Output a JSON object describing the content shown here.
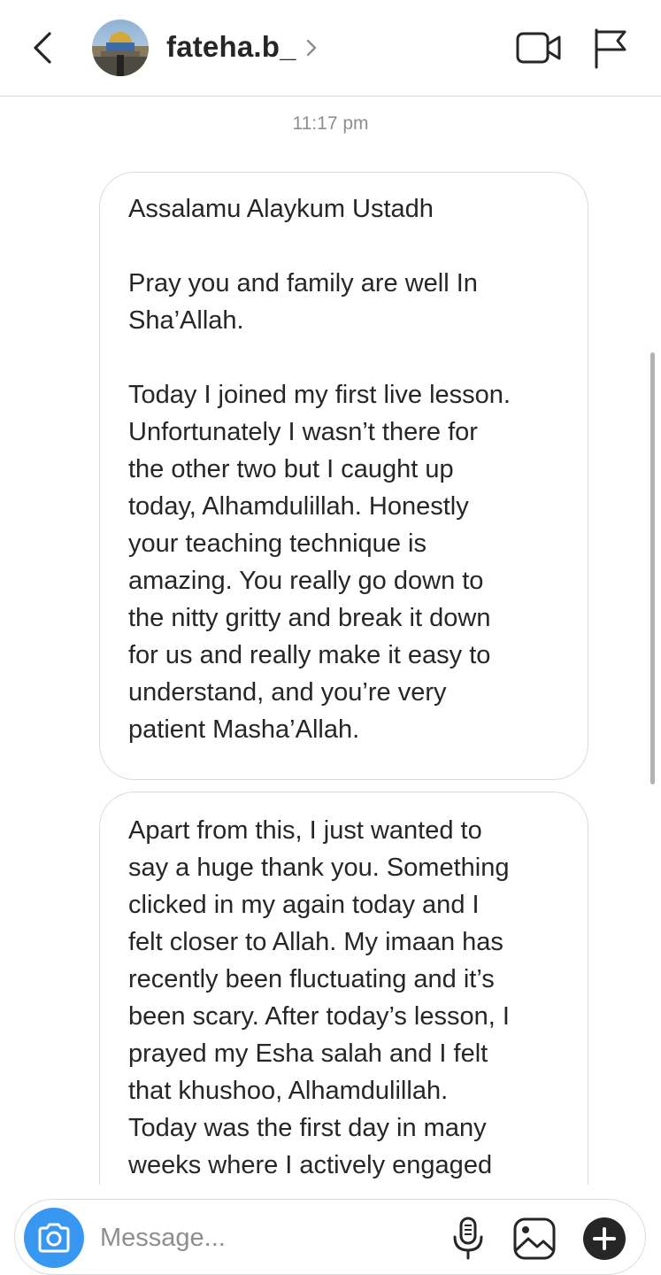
{
  "header": {
    "username": "fateha.b_",
    "chevron": "›"
  },
  "thread": {
    "timestamp": "11:17 pm",
    "messages": [
      {
        "paragraphs": [
          "Assalamu Alaykum Ustadh",
          "Pray you and family are well In\nSha’Allah.",
          "Today I joined my first live lesson.\nUnfortunately I wasn’t there for\nthe other two but I caught up\ntoday, Alhamdulillah. Honestly\nyour teaching technique is\namazing. You really go down to\nthe nitty gritty and break it down\nfor us and really make it easy to\nunderstand, and you’re very\npatient Masha’Allah."
        ]
      },
      {
        "paragraphs": [
          "Apart from this, I just wanted to\nsay a huge thank you. Something\nclicked in my again today and I\nfelt closer to Allah. My imaan has\nrecently been fluctuating and it’s\nbeen scary. After today’s lesson, I\nprayed my Esha salah and I felt\nthat khushoo, Alhamdulillah.\nToday was the first day in many\nweeks where I actively engaged"
        ]
      }
    ]
  },
  "composer": {
    "placeholder": "Message..."
  },
  "icons": {
    "back": "chevron-left-icon",
    "video": "video-camera-icon",
    "flag": "flag-icon",
    "camera": "camera-icon",
    "mic": "microphone-icon",
    "gallery": "image-icon",
    "plus": "plus-icon"
  },
  "colors": {
    "accent": "#3897f0",
    "text": "#262626",
    "muted": "#8e8e8e",
    "border": "#dbdbdb"
  }
}
